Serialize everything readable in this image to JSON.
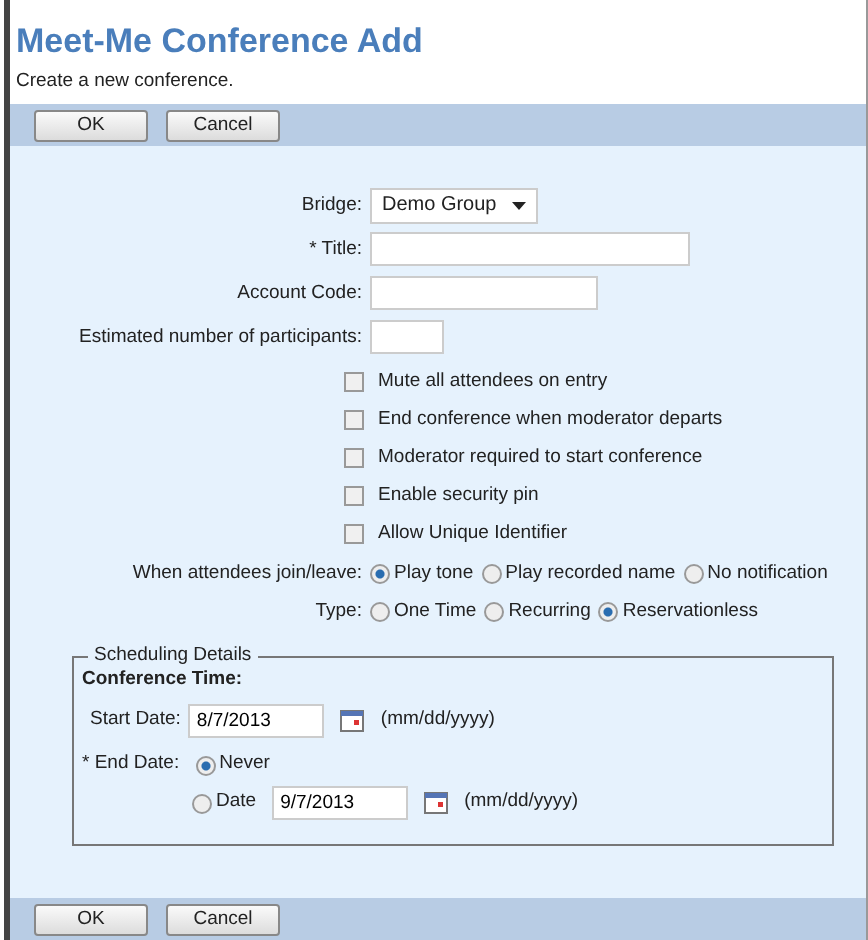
{
  "header": {
    "title": "Meet-Me Conference Add",
    "subtitle": "Create a new conference."
  },
  "toolbar_top": [
    "OK",
    "Cancel"
  ],
  "fields": [
    {
      "kind": "select",
      "label": "Bridge:",
      "value": "Demo Group"
    },
    {
      "kind": "text",
      "label": "* Title:"
    },
    {
      "kind": "text",
      "label": "Account Code:"
    },
    {
      "kind": "short",
      "label": "Estimated number of participants:"
    }
  ],
  "options": [
    {
      "label": "Mute all attendees on entry",
      "checked": false
    },
    {
      "label": "End conference when moderator departs",
      "checked": false
    },
    {
      "label": "Moderator required to start conference",
      "checked": false
    },
    {
      "label": "Enable security pin",
      "checked": false
    },
    {
      "label": "Allow Unique Identifier",
      "checked": false
    }
  ],
  "radio_groups": [
    {
      "label": "When attendees join/leave:",
      "choices": [
        {
          "label": "Play tone",
          "selected": true
        },
        {
          "label": "Play recorded name",
          "selected": false
        },
        {
          "label": "No notification",
          "selected": false
        }
      ]
    },
    {
      "label": "Type:",
      "choices": [
        {
          "label": "One Time",
          "selected": false
        },
        {
          "label": "Recurring",
          "selected": false
        },
        {
          "label": "Reservationless",
          "selected": true
        }
      ]
    }
  ],
  "scheduling": {
    "legend": "Scheduling Details",
    "heading": "Conference Time:",
    "start": {
      "label": "Start Date:",
      "value": "8/7/2013",
      "hint": "(mm/dd/yyyy)"
    },
    "end": {
      "label": "* End Date:",
      "choices": [
        {
          "label": "Never",
          "selected": true
        },
        {
          "label": "Date",
          "selected": false,
          "value": "9/7/2013",
          "hint": "(mm/dd/yyyy)"
        }
      ]
    }
  },
  "toolbar_bottom": [
    "OK",
    "Cancel"
  ]
}
